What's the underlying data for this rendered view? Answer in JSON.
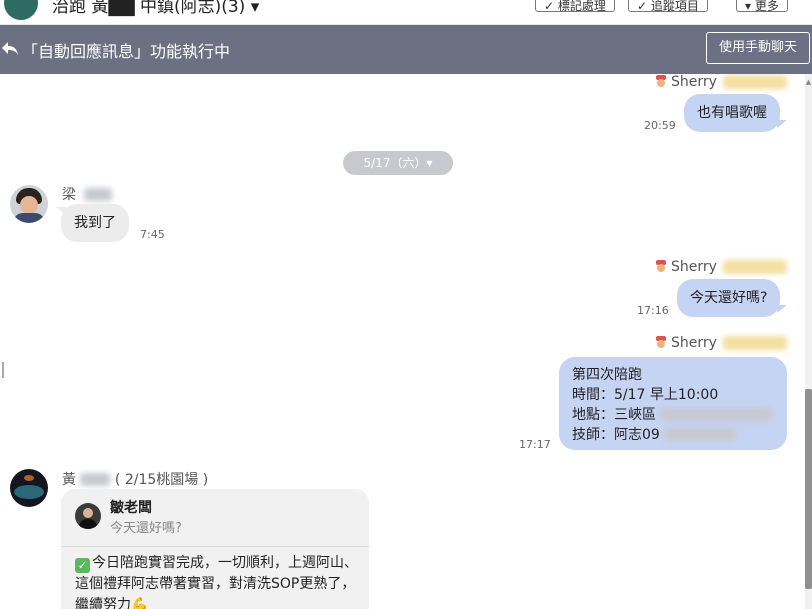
{
  "topbar": {
    "title": "治跑 黃▇▇ 中鎮(阿志)(3) ▾",
    "buttons": [
      "✓ 標記處理",
      "✓ 追蹤項目",
      "▾ 更多"
    ]
  },
  "banner": {
    "text": "「自動回應訊息」功能執行中",
    "manual_button": "使用手動聊天"
  },
  "date_separator": "5/17（六）▾",
  "messages": [
    {
      "sender": "Sherry",
      "text": "也有唱歌喔",
      "time": "20:59"
    },
    {
      "sender": "梁",
      "text": "我到了",
      "time": "7:45"
    },
    {
      "sender": "Sherry",
      "text": "今天還好嗎?",
      "time": "17:16"
    },
    {
      "sender": "Sherry",
      "lines": [
        "第四次陪跑",
        "時間：5/17  早上10:00",
        "地點：三峽區",
        "技師：阿志09"
      ],
      "time": "17:17"
    }
  ],
  "reply_card": {
    "sender": "黃",
    "sender_note": "( 2/15桃園場 )",
    "quote_name": "皺老闆",
    "quote_text": "今天還好嗎?",
    "body": "今日陪跑實習完成，一切順利，上週阿山、這個禮拜阿志帶著實習，對清洗SOP更熟了，繼續努力"
  },
  "colors": {
    "banner_bg": "#6b7183",
    "outgoing_bubble": "#c6d4f3",
    "incoming_bubble": "#ececec"
  }
}
